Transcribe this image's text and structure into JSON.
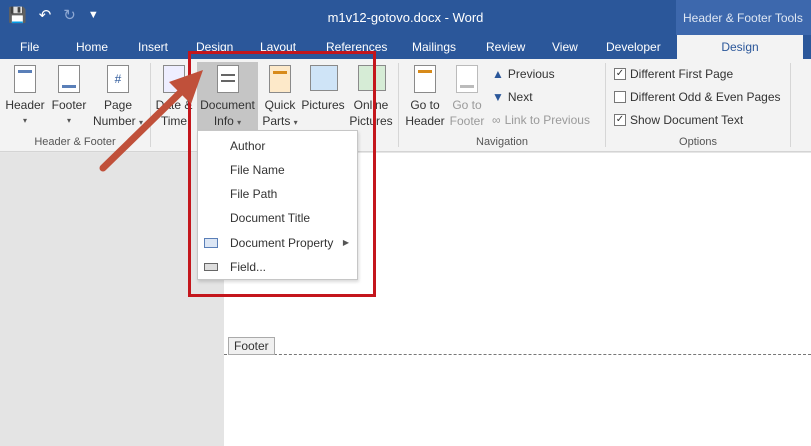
{
  "window": {
    "doc_title": "m1v12-gotovo.docx - Word",
    "context_title": "Header & Footer Tools"
  },
  "qat": {
    "save_icon": "save-icon",
    "undo_icon": "undo-icon",
    "redo_icon": "redo-icon",
    "customize_icon": "customize-icon"
  },
  "tabs": [
    "File",
    "Home",
    "Insert",
    "Design",
    "Layout",
    "References",
    "Mailings",
    "Review",
    "View",
    "Developer",
    "Design"
  ],
  "ribbon": {
    "header": {
      "line1": "Header",
      "caret": "▾"
    },
    "footer": {
      "line1": "Footer",
      "caret": "▾"
    },
    "page_number": {
      "line1": "Page",
      "line2": "Number",
      "caret": "▾"
    },
    "group_hf": "Header & Footer",
    "date_time": {
      "line1": "Date &",
      "line2": "Time"
    },
    "document_info": {
      "line1": "Document",
      "line2": "Info",
      "caret": "▾"
    },
    "quick_parts": {
      "line1": "Quick",
      "line2": "Parts",
      "caret": "▾"
    },
    "pictures": {
      "line1": "Pictures"
    },
    "online_pictures": {
      "line1": "Online",
      "line2": "Pictures"
    },
    "go_to_header": {
      "line1": "Go to",
      "line2": "Header"
    },
    "go_to_footer": {
      "line1": "Go to",
      "line2": "Footer"
    },
    "previous": "Previous",
    "next": "Next",
    "link_to_previous": "Link to Previous",
    "group_nav": "Navigation",
    "opt_diff_first": "Different First Page",
    "opt_diff_odd_even": "Different Odd & Even Pages",
    "opt_show_doc_text": "Show Document Text",
    "group_options": "Options"
  },
  "options_state": {
    "diff_first": "✓",
    "diff_odd_even": "",
    "show_doc_text": "✓"
  },
  "dropdown": {
    "items": [
      "Author",
      "File Name",
      "File Path",
      "Document Title",
      "Document Property",
      "Field..."
    ],
    "submenu_arrow": "▶"
  },
  "page": {
    "footer_tag": "Footer"
  },
  "annotation": {
    "color": "#c4161c"
  },
  "colors": {
    "accent": "#2b579a"
  }
}
